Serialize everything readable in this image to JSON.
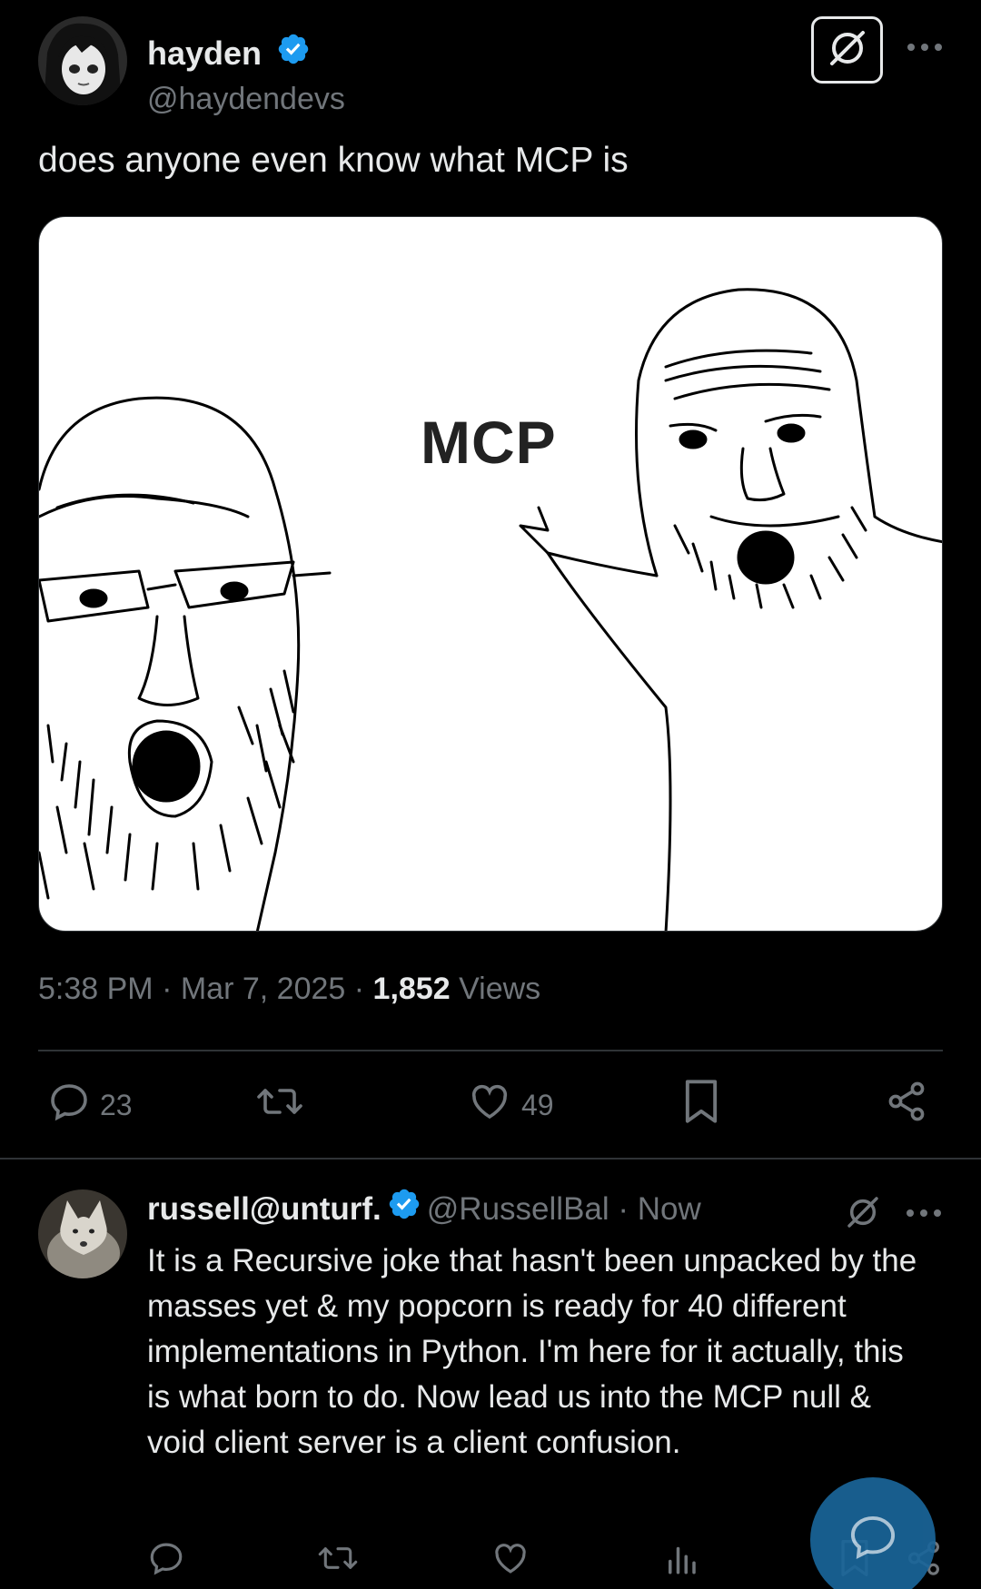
{
  "post": {
    "author_name": "hayden",
    "author_handle": "@haydendevs",
    "text": "does anyone even know what MCP is",
    "media": {
      "label": "MCP"
    },
    "time": "5:38 PM",
    "separator": "·",
    "date": "Mar 7, 2025",
    "views_count": "1,852",
    "views_label": "Views",
    "actions": {
      "replies": "23",
      "likes": "49"
    }
  },
  "reply": {
    "author_name": "russell@unturf.",
    "author_handle": "@RussellBal",
    "separator": "·",
    "time": "Now",
    "text": "It is a Recursive joke that hasn't been unpacked by the masses yet & my popcorn is ready for 40 different implementations in Python. I'm here for it actually, this is what born to do. Now lead us into the MCP null & void client server is a client confusion."
  },
  "colors": {
    "background": "#000000",
    "text_primary": "#e7e9ea",
    "text_secondary": "#71767b",
    "divider": "#2f3336",
    "verified_blue": "#1d9bf0",
    "fab_blue": "#1a6599"
  },
  "icons": {
    "verified": "verified-badge-icon",
    "grok": "grok-icon",
    "more": "more-dots-icon",
    "reply": "reply-bubble-icon",
    "repost": "repost-icon",
    "like": "heart-icon",
    "bookmark": "bookmark-icon",
    "share": "share-icon",
    "analytics": "analytics-bars-icon",
    "compose": "compose-reply-icon"
  }
}
